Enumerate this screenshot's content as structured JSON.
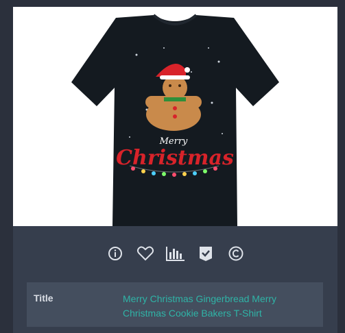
{
  "product": {
    "image_alt": "Merry Christmas gingerbread man t-shirt",
    "shirt_text_line1": "Merry",
    "shirt_text_line2": "Christmas"
  },
  "actions": [
    {
      "icon": "info-icon",
      "name": "info-button"
    },
    {
      "icon": "heart-icon",
      "name": "favorite-button"
    },
    {
      "icon": "bar-chart-icon",
      "name": "stats-button"
    },
    {
      "icon": "badge-check-icon",
      "name": "verified-button"
    },
    {
      "icon": "copyright-icon",
      "name": "copyright-button"
    }
  ],
  "details": {
    "title_label": "Title",
    "title_value": "Merry Christmas Gingerbread Merry Christmas Cookie Bakers T-Shirt"
  },
  "colors": {
    "background": "#2b303c",
    "card": "#363e4d",
    "table": "#444e5e",
    "link": "#2fb4a7",
    "icon": "#dfe3ea"
  }
}
